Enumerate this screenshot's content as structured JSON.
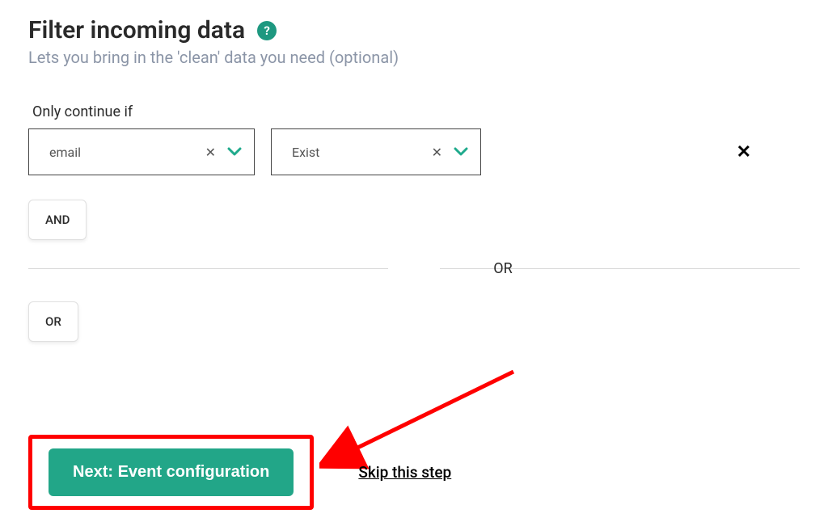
{
  "header": {
    "title": "Filter incoming data",
    "subtitle": "Lets you bring in the 'clean' data you need (optional)"
  },
  "filter": {
    "condition_label": "Only continue if",
    "field_value": "email",
    "operator_value": "Exist",
    "and_label": "AND",
    "or_label": "OR",
    "or_divider": "OR"
  },
  "footer": {
    "next_button": "Next: Event configuration",
    "skip_link": "Skip this step"
  },
  "icons": {
    "help": "?",
    "clear": "✕",
    "remove": "✕"
  }
}
